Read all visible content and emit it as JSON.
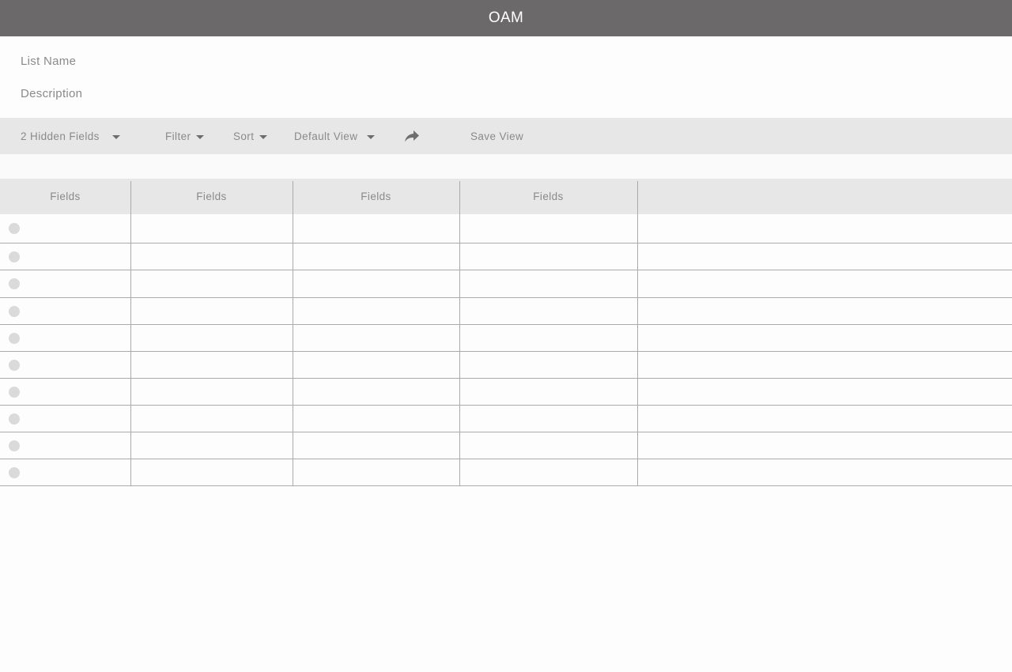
{
  "app": {
    "title": "OAM"
  },
  "list": {
    "name_label": "List Name",
    "description_label": "Description"
  },
  "toolbar": {
    "hidden_fields": "2 Hidden Fields",
    "filter": "Filter",
    "sort": "Sort",
    "view": "Default View",
    "save_view": "Save View"
  },
  "table": {
    "headers": [
      "Fields",
      "Fields",
      "Fields",
      "Fields",
      ""
    ],
    "row_count": 10
  },
  "colors": {
    "app_bar": "#6b6969",
    "toolbar": "#e7e7e7",
    "text_muted": "#8a8a8a",
    "grid_line": "#ababab",
    "row_dot": "#dadada"
  }
}
